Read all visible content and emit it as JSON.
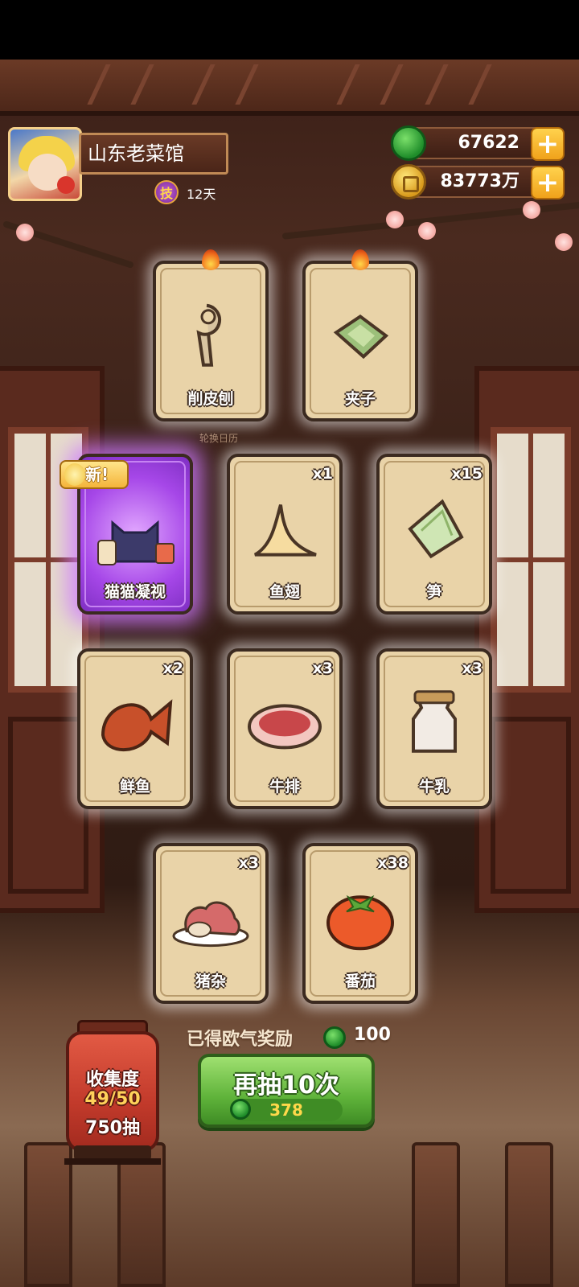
{
  "player": {
    "restaurant_name": "山东老菜馆",
    "skill_badge": "技",
    "skill_days": "12天"
  },
  "currency": {
    "jade": "67622",
    "coins": "83773万"
  },
  "calendar_label": "轮换日历",
  "cards": [
    {
      "label": "削皮刨",
      "qty": "",
      "icon": "peeler-icon",
      "flame": true
    },
    {
      "label": "夹子",
      "qty": "",
      "icon": "tongs-icon",
      "flame": true
    },
    {
      "label": "猫猫凝视",
      "qty": "",
      "icon": "cat-gaze-icon",
      "new": "新!"
    },
    {
      "label": "鱼翅",
      "qty": "x1",
      "icon": "shark-fin-icon"
    },
    {
      "label": "笋",
      "qty": "x15",
      "icon": "bamboo-shoot-icon"
    },
    {
      "label": "鲜鱼",
      "qty": "x2",
      "icon": "fish-icon"
    },
    {
      "label": "牛排",
      "qty": "x3",
      "icon": "steak-icon"
    },
    {
      "label": "牛乳",
      "qty": "x3",
      "icon": "milk-jar-icon"
    },
    {
      "label": "猪杂",
      "qty": "x3",
      "icon": "pork-offal-icon"
    },
    {
      "label": "番茄",
      "qty": "x38",
      "icon": "tomato-icon"
    }
  ],
  "reward": {
    "label": "已得欧气奖励",
    "amount": "100"
  },
  "draw_button": {
    "label": "再抽10次",
    "cost": "378"
  },
  "collection": {
    "title": "收集度",
    "progress": "49/50",
    "draws": "750抽"
  },
  "colors": {
    "jade_green": "#1f8d2a",
    "gold": "#f0a21b",
    "card_bg": "#e9d3a8",
    "special_purple": "#a647e8",
    "button_green": "#5fb33a",
    "lantern_red": "#c23a2b"
  }
}
